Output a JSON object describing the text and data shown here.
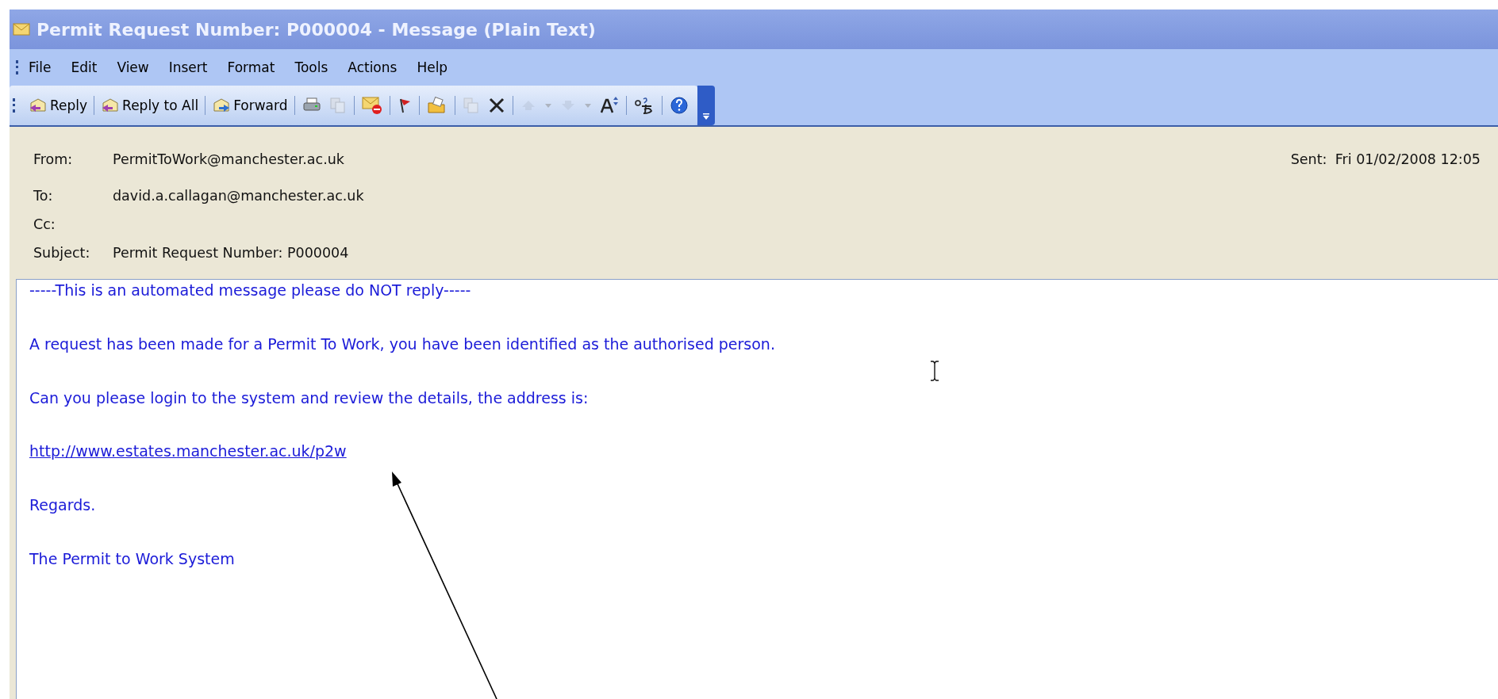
{
  "window": {
    "title": "Permit Request Number: P000004 - Message (Plain Text)"
  },
  "menu": [
    "File",
    "Edit",
    "View",
    "Insert",
    "Format",
    "Tools",
    "Actions",
    "Help"
  ],
  "toolbar": {
    "buttons": [
      {
        "label": "Reply"
      },
      {
        "label": "Reply to All"
      },
      {
        "label": "Forward"
      }
    ],
    "tools": [
      {
        "disabled": false
      },
      {
        "disabled": true
      },
      {
        "disabled": false
      },
      {
        "disabled": false
      },
      {
        "disabled": false
      },
      {
        "disabled": true
      },
      {
        "disabled": false
      },
      {
        "disabled": true
      },
      {
        "disabled": true
      },
      {
        "disabled": true
      },
      {
        "disabled": true
      },
      {
        "disabled": false
      },
      {
        "disabled": false
      },
      {
        "disabled": false
      }
    ]
  },
  "header": {
    "fields": [
      {
        "label": "From:",
        "value": "PermitToWork@manchester.ac.uk"
      },
      {
        "label": "To:",
        "value": "david.a.callagan@manchester.ac.uk"
      },
      {
        "label": "Cc:"
      },
      {
        "label": "Subject:",
        "value": "Permit Request Number: P000004"
      }
    ],
    "sent": {
      "label": "Sent:",
      "value": "Fri 01/02/2008 12:05"
    }
  },
  "body": [
    {
      "kind": "text",
      "text": "-----This is an automated message please do NOT reply-----"
    },
    {
      "kind": "text",
      "text": "A request has been made for a Permit To Work, you have been identified as the authorised person."
    },
    {
      "kind": "text",
      "text": "Can you please login to the system and review the details, the address is:"
    },
    {
      "kind": "link",
      "text": "http://www.estates.manchester.ac.uk/p2w"
    },
    {
      "kind": "text",
      "text": "Regards."
    },
    {
      "kind": "text",
      "text": "The Permit to Work System"
    }
  ]
}
